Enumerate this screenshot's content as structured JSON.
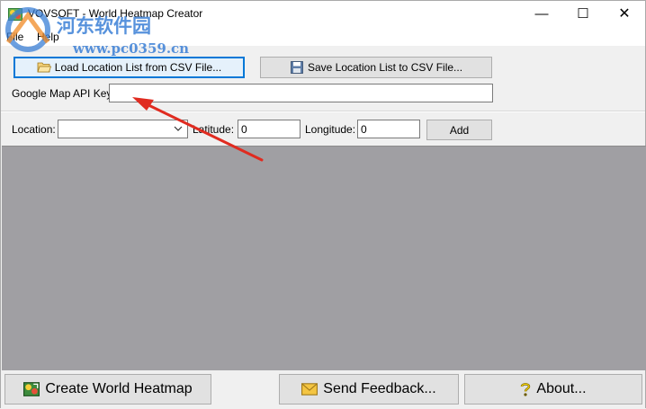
{
  "window": {
    "title": "VOVSOFT - World Heatmap Creator",
    "minimize_glyph": "—",
    "maximize_glyph": "☐",
    "close_glyph": "✕"
  },
  "watermark": {
    "line1": "河东软件园",
    "line2": "www.pc0359.cn"
  },
  "menu": {
    "items": [
      "File",
      "Help"
    ]
  },
  "toolbar": {
    "load_label": "Load Location List from CSV File...",
    "save_label": "Save Location List to CSV File..."
  },
  "api": {
    "label": "Google Map API Key:",
    "value": ""
  },
  "location": {
    "label": "Location:",
    "value": "",
    "latitude_label": "Latitude:",
    "latitude_value": "0",
    "longitude_label": "Longitude:",
    "longitude_value": "0",
    "add_label": "Add"
  },
  "bottom": {
    "create_label": "Create World Heatmap",
    "feedback_label": "Send Feedback...",
    "about_label": "About..."
  },
  "icons": {
    "app": "app-icon",
    "folder": "folder-open-icon",
    "save": "floppy-disk-icon",
    "create": "heatmap-icon",
    "feedback": "envelope-icon",
    "about": "question-mark-icon"
  },
  "colors": {
    "map_background": "#a09fa3",
    "focus_border": "#0078d7",
    "annotation_arrow": "#e02b20"
  }
}
